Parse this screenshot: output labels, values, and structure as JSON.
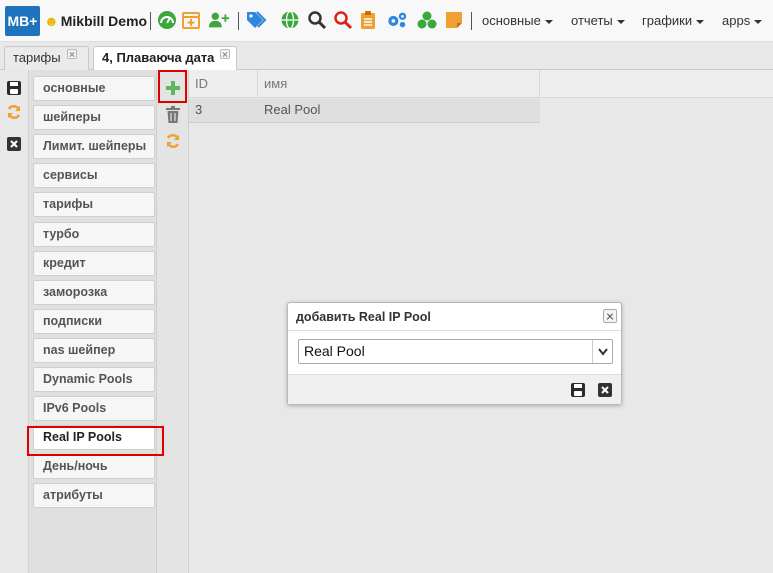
{
  "app": {
    "logo_text": "MB+",
    "brand": "Mikbill Demo",
    "menus": [
      "основные",
      "отчеты",
      "графики",
      "apps"
    ]
  },
  "tabs": [
    {
      "label": "тарифы",
      "active": false
    },
    {
      "label": "4, Плаваюча дата",
      "active": true
    }
  ],
  "side_menu": {
    "items": [
      "основные",
      "шейперы",
      "Лимит. шейперы",
      "сервисы",
      "тарифы",
      "турбо",
      "кредит",
      "заморозка",
      "подписки",
      "nas шейпер",
      "Dynamic Pools",
      "IPv6 Pools",
      "Real IP Pools",
      "День/ночь",
      "атрибуты"
    ],
    "selected": "Real IP Pools"
  },
  "grid": {
    "columns": [
      "ID",
      "имя"
    ],
    "rows": [
      [
        "3",
        "Real Pool"
      ]
    ]
  },
  "dialog": {
    "title": "добавить Real IP Pool",
    "select_value": "Real Pool"
  },
  "colors": {
    "accent_blue": "#1e73be",
    "add_green": "#5cb85c",
    "refresh_orange": "#f0a030",
    "highlight_red": "#e00000"
  },
  "icons": [
    "dashboard-icon",
    "calendar-plus-icon",
    "user-plus-icon",
    "tags-icon",
    "globe-icon",
    "search-icon",
    "search-red-icon",
    "clipboard-icon",
    "cogs-icon",
    "cubes-icon",
    "sticky-note-icon",
    "save-icon",
    "refresh-icon",
    "close-icon",
    "plus-icon",
    "trash-icon"
  ]
}
